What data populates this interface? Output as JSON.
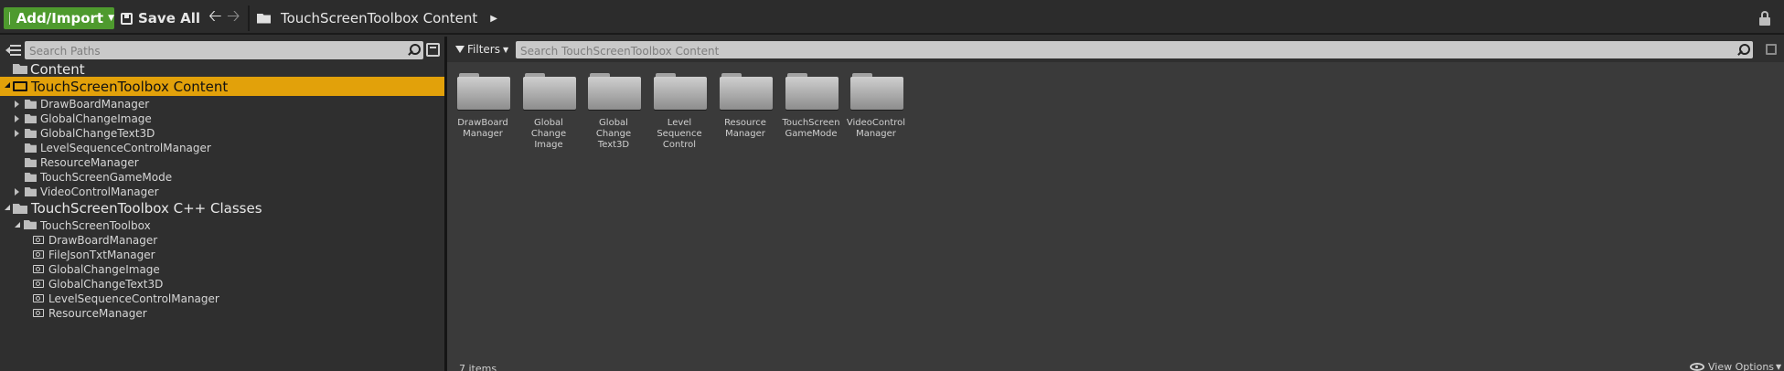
{
  "toolbar": {
    "add_import_label": "Add/Import",
    "save_all_label": "Save All",
    "breadcrumb": "TouchScreenToolbox Content"
  },
  "paths_panel": {
    "search_placeholder": "Search Paths",
    "tree": {
      "content": "Content",
      "project_content": "TouchScreenToolbox Content",
      "content_folders": [
        "DrawBoardManager",
        "GlobalChangeImage",
        "GlobalChangeText3D",
        "LevelSequenceControlManager",
        "ResourceManager",
        "TouchScreenGameMode",
        "VideoControlManager"
      ],
      "cpp_classes": "TouchScreenToolbox C++ Classes",
      "module": "TouchScreenToolbox",
      "classes": [
        "DrawBoardManager",
        "FileJsonTxtManager",
        "GlobalChangeImage",
        "GlobalChangeText3D",
        "LevelSequenceControlManager",
        "ResourceManager"
      ]
    }
  },
  "content_panel": {
    "filters_label": "Filters",
    "search_placeholder": "Search TouchScreenToolbox Content",
    "tiles": [
      "DrawBoard Manager",
      "Global Change Image",
      "Global Change Text3D",
      "Level Sequence Control",
      "Resource Manager",
      "TouchScreen GameMode",
      "VideoControl Manager"
    ],
    "items_count": "7 items",
    "view_options_label": "View Options"
  },
  "icons": {
    "add": "document-icon",
    "save": "save-icon",
    "back": "arrow-left-icon",
    "forward": "arrow-right-icon",
    "lock": "lock-icon",
    "search": "search-icon",
    "folder": "folder-icon",
    "class": "class-icon",
    "filter": "funnel-icon",
    "view": "eye-icon"
  },
  "colors": {
    "add_button": "#4e9a2e",
    "selection": "#e2a10a",
    "panel_bg": "#3a3a3a"
  }
}
